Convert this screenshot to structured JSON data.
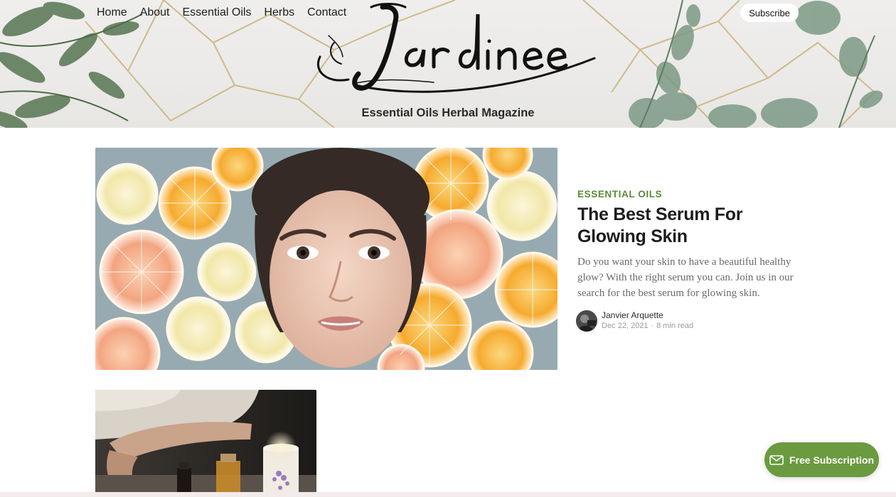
{
  "site": {
    "logo_text": "Jardinee",
    "tagline": "Essential Oils Herbal Magazine"
  },
  "nav": {
    "items": [
      "Home",
      "About",
      "Essential Oils",
      "Herbs",
      "Contact"
    ],
    "subscribe_label": "Subscribe"
  },
  "featured_post": {
    "category": "ESSENTIAL OILS",
    "title": "The Best Serum For Glowing Skin",
    "excerpt": "Do you want your skin to have a beautiful healthy glow? With the right serum you can. Join us in our search for the best serum for glowing skin.",
    "author": "Janvier Arquette",
    "date": "Dec 22, 2021",
    "separator": "·",
    "read_time": "8 min read",
    "image_subject": "woman-in-water-with-citrus-slices"
  },
  "second_post": {
    "image_subject": "essential-oil-bottles-and-candle"
  },
  "portal": {
    "label": "Free Subscription",
    "icon": "envelope-icon"
  },
  "colors": {
    "accent": "#6b9a3f",
    "category": "#5d8a3a",
    "title": "#1d1d1d",
    "excerpt": "#6a6a6a"
  }
}
